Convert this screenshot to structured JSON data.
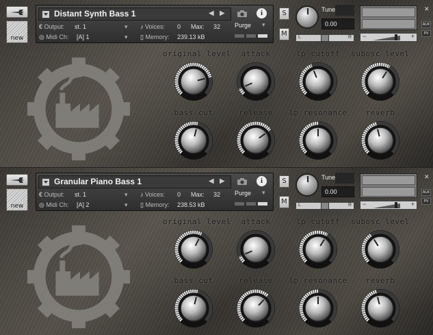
{
  "instruments": [
    {
      "name": "Distant Synth Bass 1",
      "output_label": "Output:",
      "output_value": "st. 1",
      "midi_label": "Midi Ch:",
      "midi_value": "[A]  1",
      "voices_label": "Voices:",
      "voices_value": "0",
      "max_label": "Max:",
      "max_value": "32",
      "memory_label": "Memory:",
      "memory_value": "239.13 kB",
      "purge_label": "Purge",
      "tune_label": "Tune",
      "tune_value": "0.00",
      "solo_label": "S",
      "mute_label": "M",
      "new_label": "new",
      "pan_left": "L",
      "pan_right": "R",
      "aux_label": "AUX",
      "pv_label": "PV",
      "knobs": [
        {
          "label": "original level",
          "value": 0.78
        },
        {
          "label": "attack",
          "value": 0.08
        },
        {
          "label": "lp cutoff",
          "value": 0.42
        },
        {
          "label": "subosc level",
          "value": 0.62
        },
        {
          "label": "bass cut",
          "value": 0.55
        },
        {
          "label": "release",
          "value": 0.7
        },
        {
          "label": "lp resonance",
          "value": 0.5
        },
        {
          "label": "reverb",
          "value": 0.45
        }
      ]
    },
    {
      "name": "Granular Piano Bass 1",
      "output_label": "Output:",
      "output_value": "st. 1",
      "midi_label": "Midi Ch:",
      "midi_value": "[A]  2",
      "voices_label": "Voices:",
      "voices_value": "0",
      "max_label": "Max:",
      "max_value": "32",
      "memory_label": "Memory:",
      "memory_value": "238.53 kB",
      "purge_label": "Purge",
      "tune_label": "Tune",
      "tune_value": "0.00",
      "solo_label": "S",
      "mute_label": "M",
      "new_label": "new",
      "pan_left": "L",
      "pan_right": "R",
      "aux_label": "AUX",
      "pv_label": "PV",
      "knobs": [
        {
          "label": "original level",
          "value": 0.6
        },
        {
          "label": "attack",
          "value": 0.08
        },
        {
          "label": "lp cutoff",
          "value": 0.62
        },
        {
          "label": "subosc level",
          "value": 0.38
        },
        {
          "label": "bass cut",
          "value": 0.55
        },
        {
          "label": "release",
          "value": 0.66
        },
        {
          "label": "lp resonance",
          "value": 0.5
        },
        {
          "label": "reverb",
          "value": 0.45
        }
      ]
    }
  ],
  "colors": {
    "knob_ring": "#e8e8e8",
    "knob_track": "#3a3a3a",
    "panel": "#3a3a3a"
  }
}
